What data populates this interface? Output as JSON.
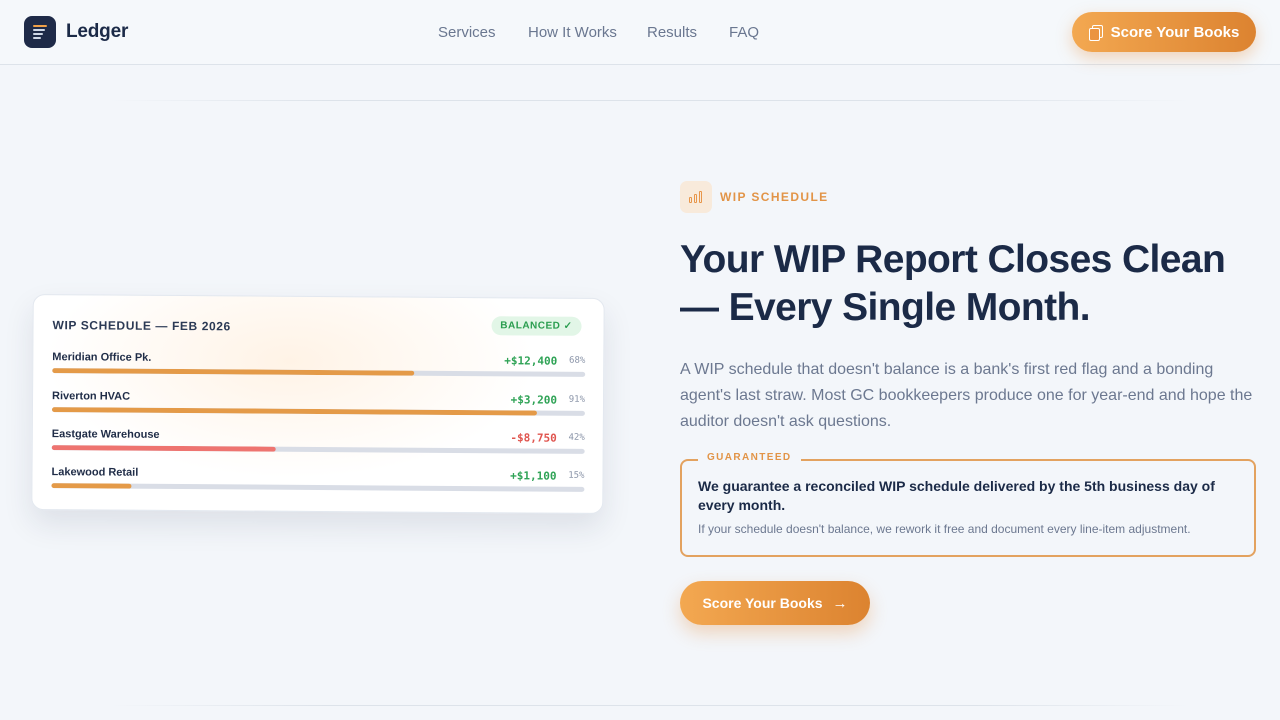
{
  "header": {
    "brand": "Ledger",
    "nav": [
      "Services",
      "How It Works",
      "Results",
      "FAQ"
    ],
    "cta_label": "Score Your Books"
  },
  "card": {
    "title": "WIP SCHEDULE — FEB 2026",
    "badge": "BALANCED ✓",
    "rows": [
      {
        "name": "Meridian Office Pk.",
        "amount": "+$12,400",
        "percent": "68%",
        "progress": 0.68,
        "negative": false
      },
      {
        "name": "Riverton HVAC",
        "amount": "+$3,200",
        "percent": "91%",
        "progress": 0.91,
        "negative": false
      },
      {
        "name": "Eastgate Warehouse",
        "amount": "-$8,750",
        "percent": "42%",
        "progress": 0.42,
        "negative": true
      },
      {
        "name": "Lakewood Retail",
        "amount": "+$1,100",
        "percent": "15%",
        "progress": 0.15,
        "negative": false
      }
    ]
  },
  "hero": {
    "eyebrow": "WIP SCHEDULE",
    "headline": "Your WIP Report Closes Clean — Every Single Month.",
    "body": "A WIP schedule that doesn't balance is a bank's first red flag and a bonding agent's last straw. Most GC bookkeepers produce one for year-end and hope the auditor doesn't ask questions.",
    "guarantee_tag": "GUARANTEED",
    "guarantee_main": "We guarantee a reconciled WIP schedule delivered by the 5th business day of every month.",
    "guarantee_sub": "If your schedule doesn't balance, we rework it free and document every line-item adjustment.",
    "cta_label": "Score Your Books",
    "cta_arrow": "→"
  },
  "colors": {
    "accent": "#e8964a",
    "navy": "#1b2a47",
    "positive": "#2fa356",
    "negative": "#e0554f"
  }
}
